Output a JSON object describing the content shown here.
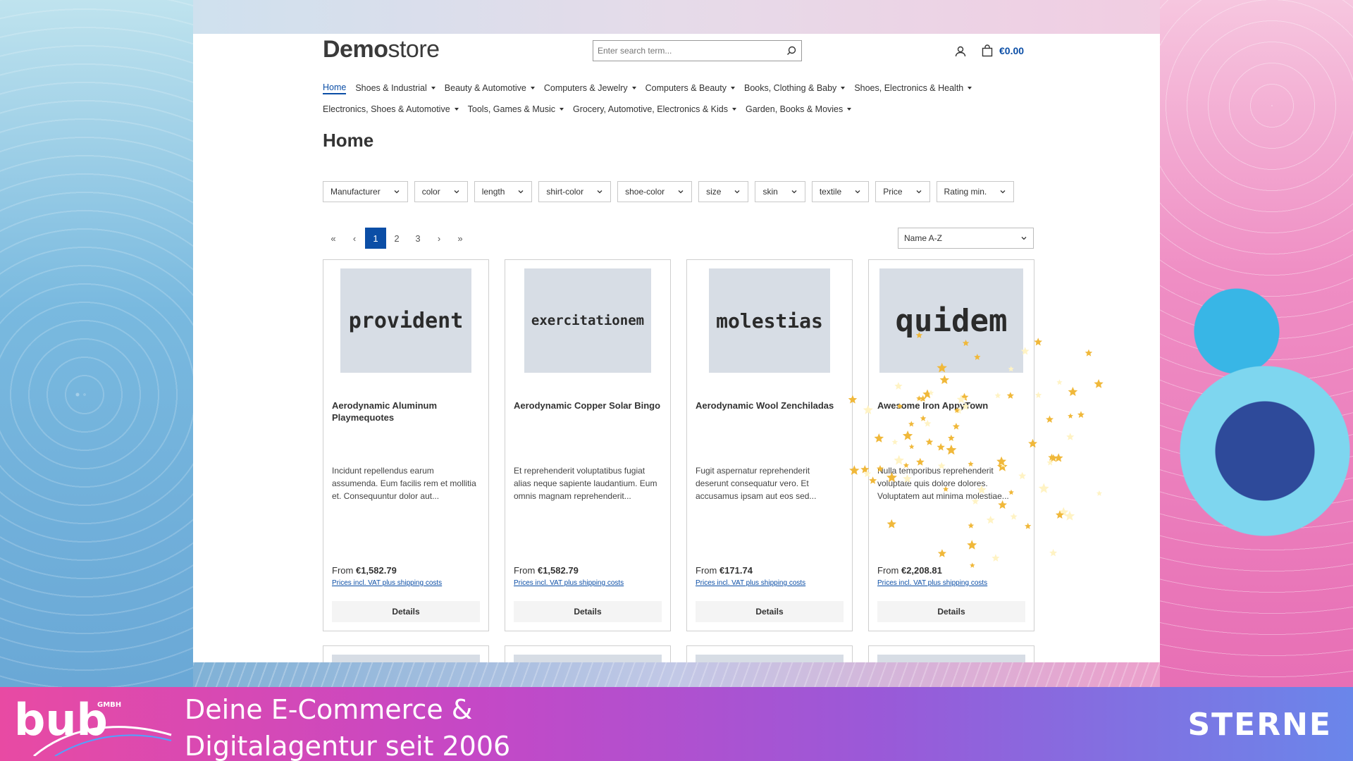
{
  "store": {
    "logo_bold": "Demo",
    "logo_light": "store",
    "search_placeholder": "Enter search term...",
    "cart_amount": "€0.00"
  },
  "nav": {
    "row1": [
      {
        "label": "Home",
        "active": true
      },
      {
        "label": "Shoes & Industrial"
      },
      {
        "label": "Beauty & Automotive"
      },
      {
        "label": "Computers & Jewelry"
      },
      {
        "label": "Computers & Beauty"
      },
      {
        "label": "Books, Clothing & Baby"
      },
      {
        "label": "Shoes, Electronics & Health"
      }
    ],
    "row2": [
      {
        "label": "Electronics, Shoes & Automotive"
      },
      {
        "label": "Tools, Games & Music"
      },
      {
        "label": "Grocery, Automotive, Electronics & Kids"
      },
      {
        "label": "Garden, Books & Movies"
      }
    ]
  },
  "page_title": "Home",
  "filters": [
    "Manufacturer",
    "color",
    "length",
    "shirt-color",
    "shoe-color",
    "size",
    "skin",
    "textile",
    "Price",
    "Rating min."
  ],
  "pagination": {
    "first": "«",
    "prev": "‹",
    "pages": [
      "1",
      "2",
      "3"
    ],
    "current": "1",
    "next": "›",
    "last": "»"
  },
  "sort": {
    "selected": "Name A-Z"
  },
  "products": [
    {
      "image_text": "provident",
      "name": "Aerodynamic Aluminum Playmequotes",
      "description": "Incidunt repellendus earum assumenda. Eum facilis rem et mollitia et. Consequuntur dolor aut...",
      "price_prefix": "From",
      "price": "€1,582.79",
      "tax_note": "Prices incl. VAT plus shipping costs",
      "button": "Details"
    },
    {
      "image_text": "exercitationem",
      "name": "Aerodynamic Copper Solar Bingo",
      "description": "Et reprehenderit voluptatibus fugiat alias neque sapiente laudantium. Eum omnis magnam reprehenderit...",
      "price_prefix": "From",
      "price": "€1,582.79",
      "tax_note": "Prices incl. VAT plus shipping costs",
      "button": "Details"
    },
    {
      "image_text": "molestias",
      "name": "Aerodynamic Wool Zenchiladas",
      "description": "Fugit aspernatur reprehenderit deserunt consequatur vero. Et accusamus ipsam aut eos sed...",
      "price_prefix": "From",
      "price": "€171.74",
      "tax_note": "Prices incl. VAT plus shipping costs",
      "button": "Details"
    },
    {
      "image_text": "quidem",
      "name": "Awesome Iron AppyTown",
      "description": "Nulla temporibus reprehenderit voluptate quis dolore dolores. Voluptatem aut minima molestiae...",
      "price_prefix": "From",
      "price": "€2,208.81",
      "tax_note": "Prices incl. VAT plus shipping costs",
      "button": "Details"
    }
  ],
  "banner": {
    "logo_text": "bub",
    "logo_sub": "GMBH",
    "tagline_line1": "Deine E-Commerce &",
    "tagline_line2": "Digitalagentur seit 2006",
    "right_text": "STERNE"
  },
  "colors": {
    "accent": "#0b4ea6",
    "star": "#f0b83a"
  },
  "icons": [
    "search-icon",
    "user-icon",
    "cart-icon",
    "chevron-down-icon",
    "star-icon"
  ]
}
